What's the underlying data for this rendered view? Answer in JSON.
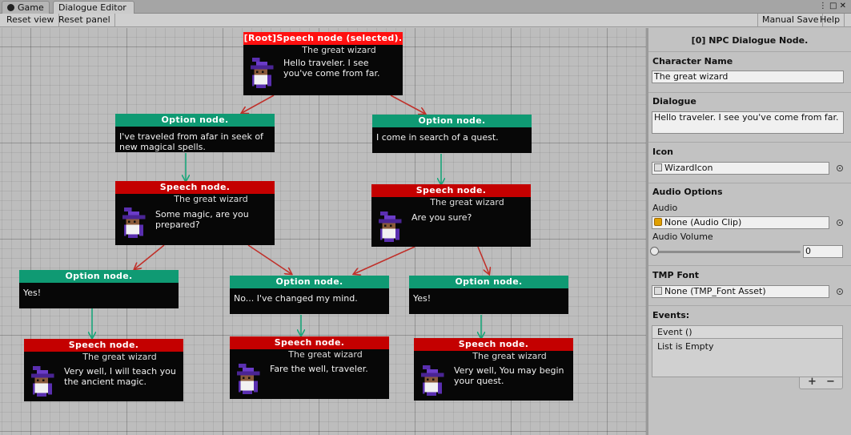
{
  "tabs": {
    "game": "Game",
    "dialogue_editor": "Dialogue Editor"
  },
  "tab_menu": "⋮ □ ✕",
  "toolbar": {
    "reset_view": "Reset view",
    "reset_panel": "Reset panel",
    "manual_save": "Manual Save",
    "help": "Help"
  },
  "nodes": [
    {
      "kind": "speech",
      "header": "[Root]Speech node (selected).",
      "speaker": "The great wizard",
      "text": "Hello traveler. I see you've come from far."
    },
    {
      "kind": "option",
      "header": "Option node.",
      "text": "I've traveled from afar in seek of new magical spells."
    },
    {
      "kind": "option",
      "header": "Option node.",
      "text": "I come in search of a quest."
    },
    {
      "kind": "speech",
      "header": "Speech node.",
      "speaker": "The great wizard",
      "text": "Some magic, are you prepared?"
    },
    {
      "kind": "speech",
      "header": "Speech node.",
      "speaker": "The great wizard",
      "text": "Are you sure?"
    },
    {
      "kind": "option",
      "header": "Option node.",
      "text": "Yes!"
    },
    {
      "kind": "option",
      "header": "Option node.",
      "text": "No... I've changed my mind."
    },
    {
      "kind": "option",
      "header": "Option node.",
      "text": "Yes!"
    },
    {
      "kind": "speech",
      "header": "Speech node.",
      "speaker": "The great wizard",
      "text": "Very well, I will teach you the ancient magic."
    },
    {
      "kind": "speech",
      "header": "Speech node.",
      "speaker": "The great wizard",
      "text": "Fare the well, traveler."
    },
    {
      "kind": "speech",
      "header": "Speech node.",
      "speaker": "The great wizard",
      "text": "Very well, You may begin your quest."
    }
  ],
  "inspector": {
    "title": "[0] NPC Dialogue Node.",
    "character_name_label": "Character Name",
    "character_name_value": "The great wizard",
    "dialogue_label": "Dialogue",
    "dialogue_value": "Hello traveler. I see you've come from far.",
    "icon_label": "Icon",
    "icon_value": "WizardIcon",
    "audio_options_label": "Audio Options",
    "audio_label": "Audio",
    "audio_value": "None (Audio Clip)",
    "audio_volume_label": "Audio Volume",
    "audio_volume_value": "0",
    "tmp_font_label": "TMP Font",
    "tmp_font_value": "None (TMP_Font Asset)",
    "events_label": "Events:",
    "event_header": "Event ()",
    "event_list_empty": "List is Empty",
    "add_symbol": "+",
    "remove_symbol": "−"
  },
  "colors": {
    "speech_header": "#c40000",
    "root_header": "#ff1010",
    "option_header": "#0f9a73",
    "link_speech_to_option": "#c0302a",
    "link_option_to_speech": "#1aa67a"
  }
}
